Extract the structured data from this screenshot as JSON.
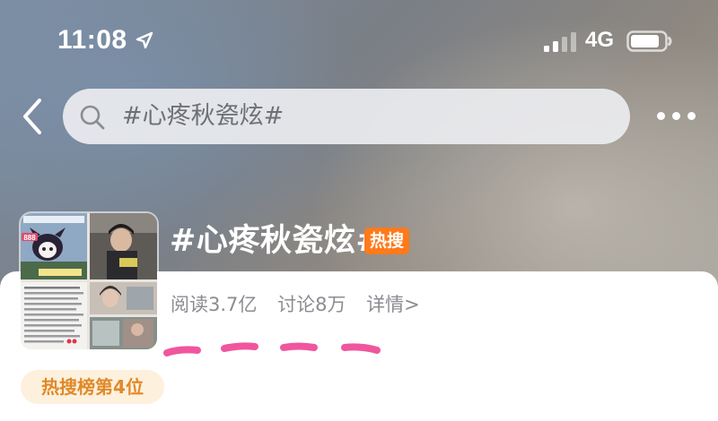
{
  "status_bar": {
    "time": "11:08",
    "network": "4G"
  },
  "search": {
    "query": "#心疼秋瓷炫#"
  },
  "topic": {
    "title": "#心疼秋瓷炫#",
    "hot_badge": "热搜",
    "reads": "阅读3.7亿",
    "discussions": "讨论8万",
    "detail_link": "详情>",
    "rank": "热搜榜第4位"
  },
  "thumbnail": {
    "count_label": "888"
  },
  "colors": {
    "hot_badge": "#ff7a1a",
    "rank_badge_bg": "#fdf0dc",
    "rank_badge_text": "#e0892a",
    "annotation_squiggle": "#f0569e"
  }
}
